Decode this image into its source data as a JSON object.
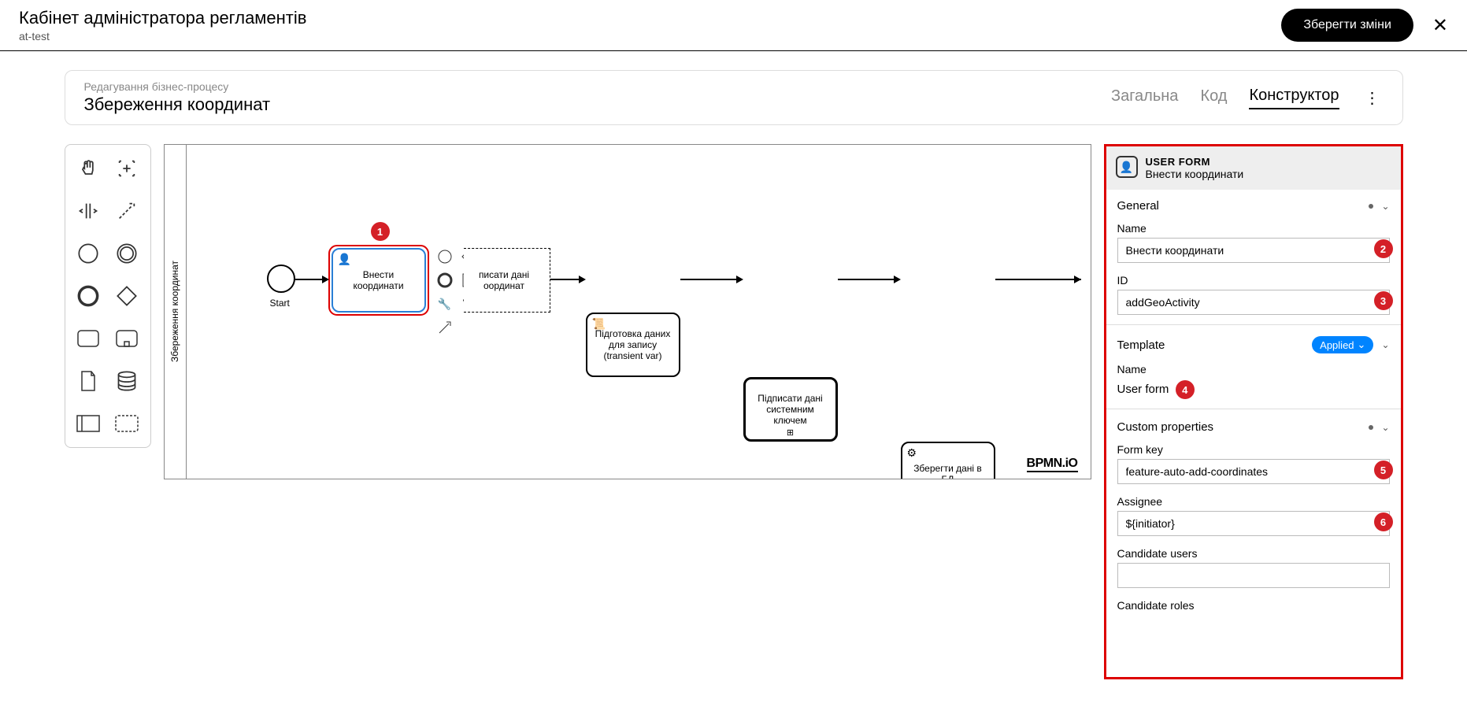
{
  "header": {
    "title": "Кабінет адміністратора регламентів",
    "subtitle": "at-test",
    "save_label": "Зберегти зміни"
  },
  "subheader": {
    "crumb": "Редагування бізнес-процесу",
    "title": "Збереження координат",
    "tabs": {
      "general": "Загальна",
      "code": "Код",
      "constructor": "Конструктор"
    }
  },
  "canvas": {
    "lane_label": "Збереження координат",
    "watermark": "BPMN.iO",
    "nodes": {
      "start": "Start",
      "task1": "Внести координати",
      "task2": "писати дані оординат",
      "task3": "Підготовка даних для запису (transient var)",
      "task4": "Підписати дані системним ключем",
      "task5": "Зберегти дані в БД"
    }
  },
  "panel": {
    "type": "USER FORM",
    "name_display": "Внести координати",
    "sections": {
      "general": "General",
      "name_label": "Name",
      "name_value": "Внести координати",
      "id_label": "ID",
      "id_value": "addGeoActivity",
      "template": "Template",
      "applied": "Applied",
      "template_name_label": "Name",
      "template_name_value": "User form",
      "custom": "Custom properties",
      "formkey_label": "Form key",
      "formkey_value": "feature-auto-add-coordinates",
      "assignee_label": "Assignee",
      "assignee_value": "${initiator}",
      "cand_users_label": "Candidate users",
      "cand_users_value": "",
      "cand_roles_label": "Candidate roles"
    }
  },
  "badges": {
    "b1": "1",
    "b2": "2",
    "b3": "3",
    "b4": "4",
    "b5": "5",
    "b6": "6"
  }
}
